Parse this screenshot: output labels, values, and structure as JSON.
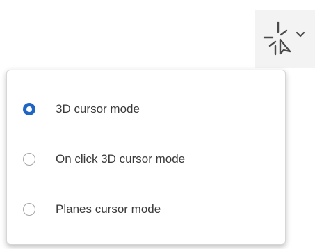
{
  "toolbar": {
    "cursor_tool_icon": "crosshair-cursor-icon",
    "dropdown_icon": "chevron-down-icon",
    "icon_color": "#4a4a4a",
    "button_bg": "#f3f3f3"
  },
  "menu": {
    "items": [
      {
        "label": "3D cursor mode",
        "selected": true
      },
      {
        "label": "On click 3D cursor mode",
        "selected": false
      },
      {
        "label": "Planes cursor mode",
        "selected": false
      }
    ],
    "accent_color": "#1f66c4"
  }
}
